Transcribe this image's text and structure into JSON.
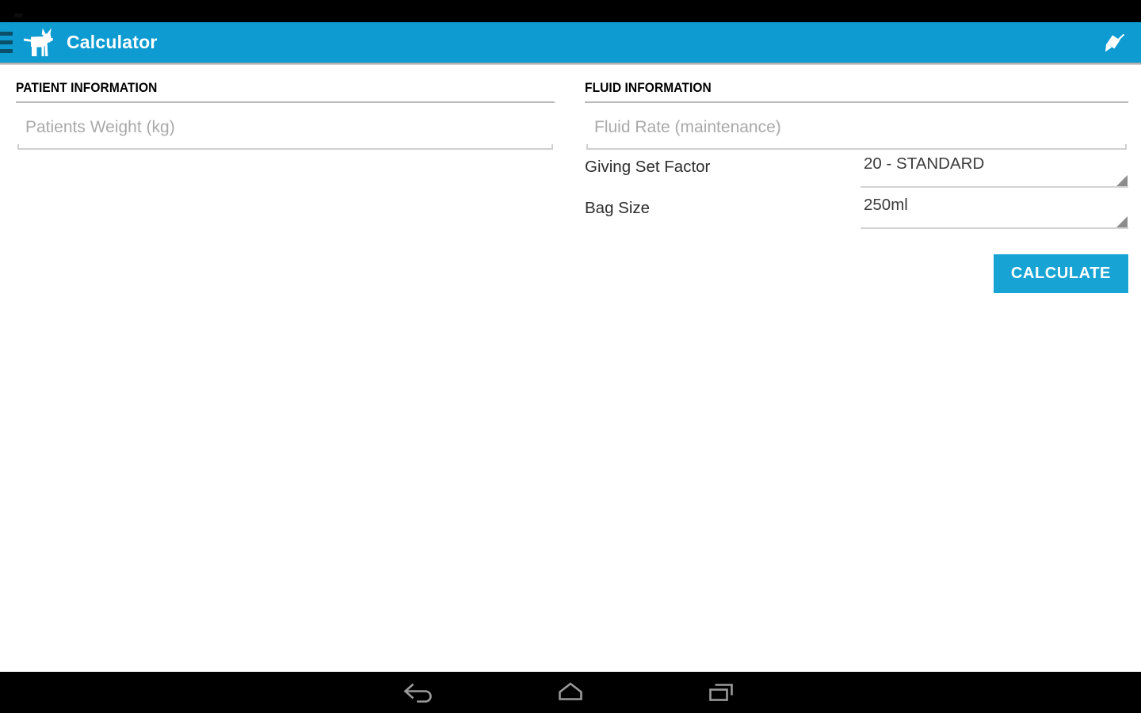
{
  "theme": {
    "toolbar_color": "#0d9bd1",
    "button_color": "#17a3d4",
    "accent_text": "#ffffff",
    "placeholder_color": "#a9a9a9",
    "divider_color": "#b9b9b9",
    "nav_bar_color": "#000000",
    "status_bar_color": "#000000"
  },
  "toolbar": {
    "title": "Calculator",
    "menu_icon": "hamburger-menu-icon",
    "logo_icon": "dog-logo-icon",
    "pin_icon": "pin-icon"
  },
  "patient_section": {
    "title": "PATIENT INFORMATION",
    "weight_field": {
      "placeholder": "Patients Weight (kg)",
      "value": ""
    }
  },
  "fluid_section": {
    "title": "FLUID INFORMATION",
    "fluid_rate_field": {
      "placeholder": "Fluid Rate (maintenance)",
      "value": ""
    },
    "giving_set_factor": {
      "label": "Giving Set Factor",
      "value": "20 - STANDARD"
    },
    "bag_size": {
      "label": "Bag Size",
      "value": "250ml"
    },
    "calculate_button": "CALCULATE"
  },
  "nav_bar": {
    "back": "back-icon",
    "home": "home-icon",
    "recents": "recents-icon"
  }
}
